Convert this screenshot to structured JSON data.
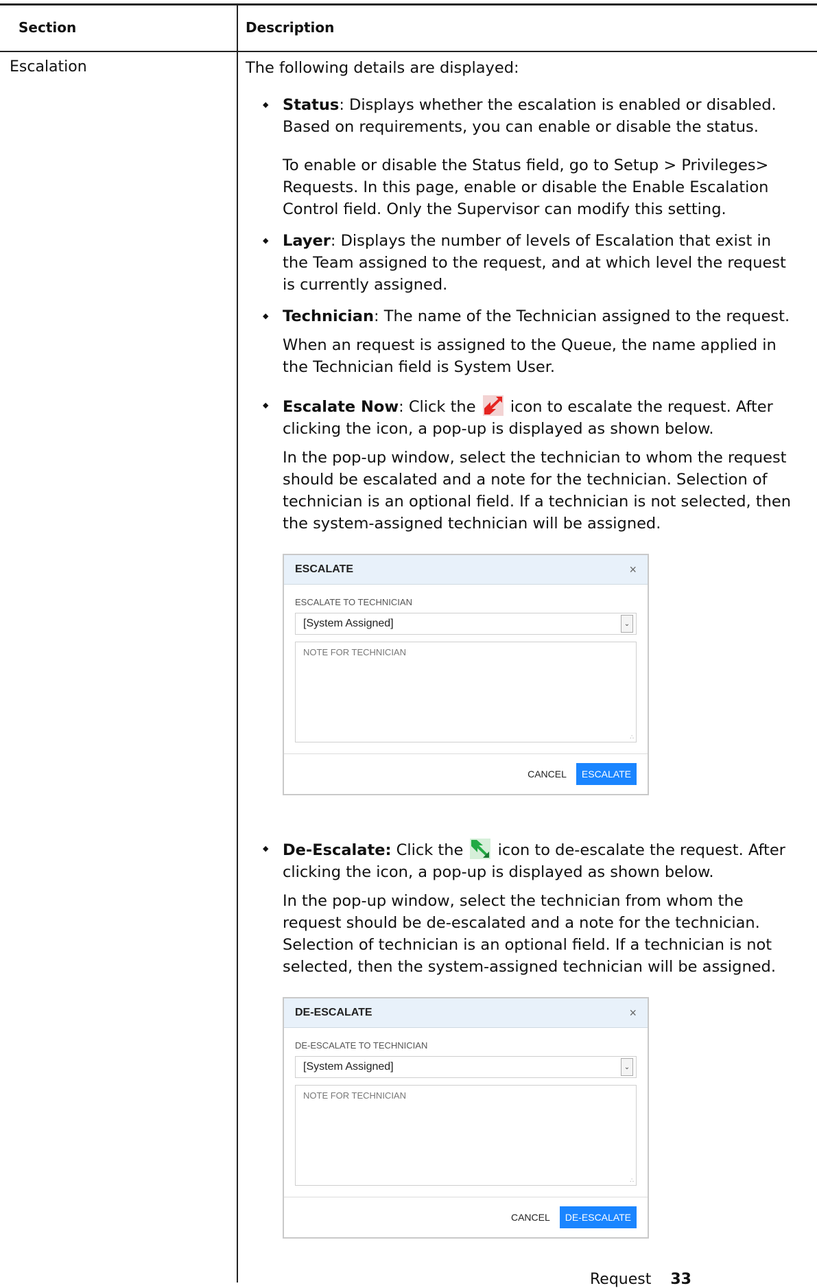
{
  "table": {
    "header_section": "Section",
    "header_description": "Description",
    "row_section": "Escalation"
  },
  "content": {
    "intro": "The following details are displayed:",
    "status": {
      "label": "Status",
      "text": ": Displays whether the escalation is enabled or disabled. Based on requirements, you can enable or disable the status.",
      "sub": "To enable or disable the Status field, go to Setup > Privileges> Requests. In this page, enable or disable the Enable Escalation Control field. Only the Supervisor can modify this setting."
    },
    "layer": {
      "label": "Layer",
      "text": ": Displays the number of levels of Escalation that exist in the Team assigned to the request, and at which level the request is currently assigned."
    },
    "technician": {
      "label": "Technician",
      "text": ": The name of the Technician assigned to the request.",
      "sub": "When an request is assigned to the Queue, the name applied in the Technician field is System User."
    },
    "escalate_now": {
      "label": "Escalate Now",
      "text_before_icon": ": Click the ",
      "text_after_icon": " icon to escalate the request. After clicking the icon, a pop-up is displayed as shown below.",
      "sub": "In the pop-up window, select the technician to whom the request should be escalated and a note for the technician. Selection of technician is an optional field. If a technician is not selected, then the system-assigned technician will be assigned.",
      "icon": "escalate-icon",
      "icon_color": "#e52420"
    },
    "de_escalate": {
      "label": "De-Escalate:",
      "text_before_icon": " Click the ",
      "text_after_icon": " icon to de-escalate the request. After clicking the icon, a pop-up is displayed as shown below.",
      "sub": "In the pop-up window, select the technician from whom the request should be de-escalated and a note for the technician. Selection of technician is an optional field. If a technician is not selected, then the system-assigned technician will be assigned.",
      "icon": "de-escalate-icon",
      "icon_color": "#22aa44"
    }
  },
  "escalate_dialog": {
    "title": "ESCALATE",
    "close": "×",
    "field_label": "ESCALATE TO TECHNICIAN",
    "selected": "[System Assigned]",
    "note_placeholder": "NOTE FOR TECHNICIAN",
    "cancel": "CANCEL",
    "primary": "ESCALATE"
  },
  "deescalate_dialog": {
    "title": "DE-ESCALATE",
    "close": "×",
    "field_label": "DE-ESCALATE TO TECHNICIAN",
    "selected": "[System Assigned]",
    "note_placeholder": "NOTE FOR TECHNICIAN",
    "cancel": "CANCEL",
    "primary": "DE-ESCALATE"
  },
  "footer": {
    "section": "Request",
    "page": "33"
  },
  "colors": {
    "primary_button": "#1a85ff",
    "dialog_header": "#e8f1fa"
  }
}
